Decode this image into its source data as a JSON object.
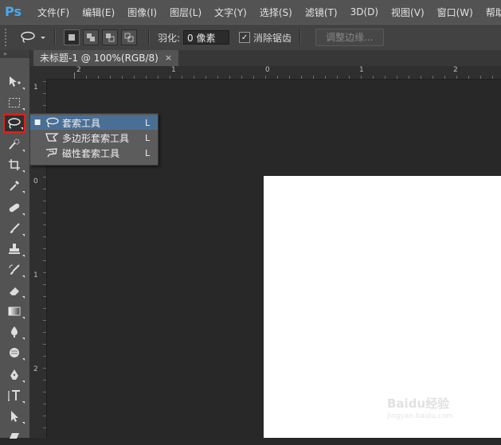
{
  "app": {
    "logo": "Ps",
    "brand_color": "#4aa9f0"
  },
  "menu": [
    "文件(F)",
    "编辑(E)",
    "图像(I)",
    "图层(L)",
    "文字(Y)",
    "选择(S)",
    "滤镜(T)",
    "3D(D)",
    "视图(V)",
    "窗口(W)",
    "帮助(H)"
  ],
  "options": {
    "tool_icon": "lasso-icon",
    "feather_label": "羽化:",
    "feather_value": "0 像素",
    "antialias_label": "消除锯齿",
    "antialias_checked": true,
    "refine_edge_label": "调整边缘..."
  },
  "document": {
    "tab_title": "未标题-1 @ 100%(RGB/8)",
    "close_glyph": "×",
    "canvas_color": "#ffffff",
    "pasteboard_color": "#282828"
  },
  "rulers": {
    "top_labels": [
      "2",
      "1",
      "0",
      "1",
      "2"
    ],
    "left_labels": [
      "1",
      "0",
      "1",
      "2"
    ]
  },
  "toolbar": {
    "header": "»",
    "tools": [
      "move-icon",
      "marquee-icon",
      "lasso-icon",
      "quick-select-icon",
      "crop-icon",
      "eyedropper-icon",
      "healing-icon",
      "brush-icon",
      "stamp-icon",
      "history-brush-icon",
      "eraser-icon",
      "gradient-icon",
      "blur-icon",
      "dodge-icon",
      "pen-icon",
      "type-icon",
      "path-select-icon",
      "shape-icon"
    ],
    "selected_tool": "lasso-icon",
    "selected_highlight": "#e0201c"
  },
  "flyout": {
    "items": [
      {
        "label": "套索工具",
        "shortcut": "L",
        "active": true,
        "icon": "lasso-icon"
      },
      {
        "label": "多边形套索工具",
        "shortcut": "L",
        "active": false,
        "icon": "polygonal-lasso-icon"
      },
      {
        "label": "磁性套索工具",
        "shortcut": "L",
        "active": false,
        "icon": "magnetic-lasso-icon"
      }
    ],
    "bullet": "■",
    "highlight_color": "#4a6f95"
  },
  "watermark": {
    "brand": "Baidu经验",
    "url": "jingyan.baidu.com"
  }
}
